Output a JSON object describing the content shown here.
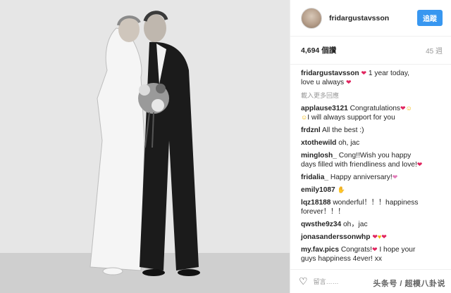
{
  "post": {
    "username": "fridargustavsson",
    "follow_label": "追蹤",
    "views": "4,694 個讚",
    "time": "45 週"
  },
  "caption": {
    "user": "fridargustavsson",
    "text_1": " 1 year today,",
    "text_2": "love u always "
  },
  "load_more": "載入更多回應",
  "comments": [
    {
      "user": "applause3121",
      "text": " Congratulations",
      "text2": "I will always support for you"
    },
    {
      "user": "frdznl",
      "text": " All the best :)"
    },
    {
      "user": "xtothewild",
      "text": " oh, jac"
    },
    {
      "user": "minglosh_",
      "text": " Cong!!Wish you happy",
      "text2": "days filled with friendliness and love!"
    },
    {
      "user": "fridalia_",
      "text": " Happy anniversary!"
    },
    {
      "user": "emily1087",
      "text": " "
    },
    {
      "user": "lqz18188",
      "text": " wonderful！！！happiness",
      "text2": "forever！！！"
    },
    {
      "user": "qwsthe9z34",
      "text": " oh，jac"
    },
    {
      "user": "jonasanderssonwhp",
      "text": " "
    },
    {
      "user": "my.fav.pics",
      "text": " Congrats!",
      "text2": " I hope your",
      "text3": "guys happiness 4ever! xx"
    }
  ],
  "footer": {
    "placeholder": "留言……"
  },
  "watermark": "头条号 / 超模八卦说",
  "icons": {
    "heart": "heart-icon",
    "like": "like-icon"
  },
  "colors": {
    "accent": "#3897f0",
    "heart": "#e0245e"
  }
}
